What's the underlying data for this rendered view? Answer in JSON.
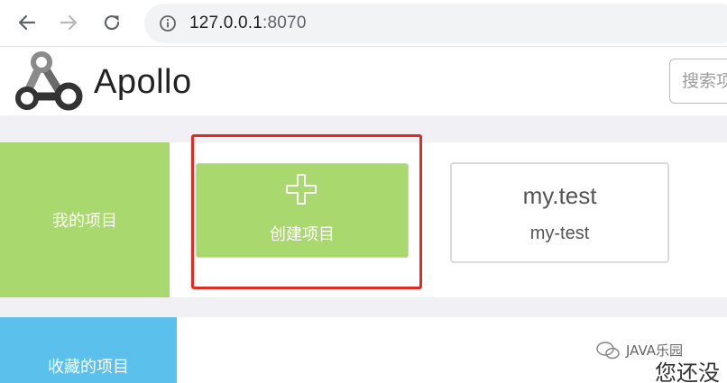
{
  "browser": {
    "url_host": "127.0.0.1",
    "url_port": ":8070",
    "icons": {
      "back": "arrow-left-icon",
      "forward": "arrow-right-icon",
      "reload": "reload-icon",
      "info": "info-icon"
    }
  },
  "header": {
    "app_name": "Apollo",
    "search_placeholder": "搜索项"
  },
  "sections": {
    "mine_label": "我的项目",
    "favorites_label": "收藏的项目"
  },
  "create_card": {
    "label": "创建项目",
    "icon": "plus-icon"
  },
  "projects": [
    {
      "name": "my.test",
      "app_id": "my-test"
    }
  ],
  "watermark": {
    "brand": "JAVA乐园",
    "empty_text": "您还没"
  },
  "colors": {
    "accent_green": "#a9d86e",
    "accent_blue": "#5bc0eb",
    "highlight_red": "#e12b25",
    "band_gray": "#f0f0f5"
  }
}
